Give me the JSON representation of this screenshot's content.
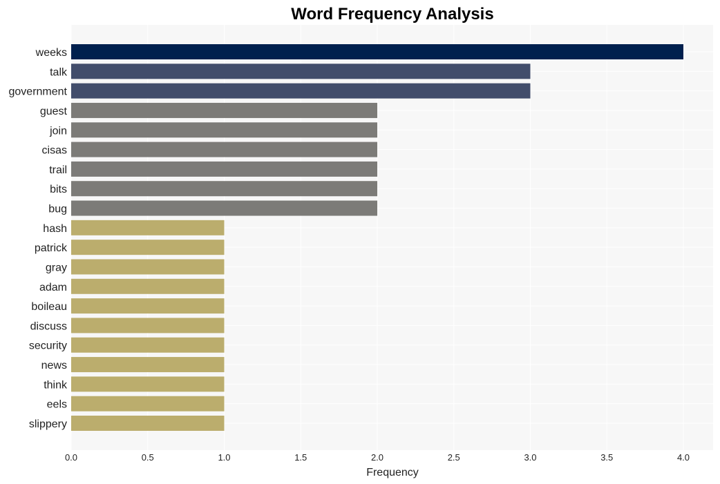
{
  "chart_data": {
    "type": "bar",
    "orientation": "horizontal",
    "title": "Word Frequency Analysis",
    "xlabel": "Frequency",
    "ylabel": "",
    "xlim": [
      0,
      4.2
    ],
    "xticks": [
      "0.0",
      "0.5",
      "1.0",
      "1.5",
      "2.0",
      "2.5",
      "3.0",
      "3.5",
      "4.0"
    ],
    "grid": true,
    "categories": [
      "weeks",
      "talk",
      "government",
      "guest",
      "join",
      "cisas",
      "trail",
      "bits",
      "bug",
      "hash",
      "patrick",
      "gray",
      "adam",
      "boileau",
      "discuss",
      "security",
      "news",
      "think",
      "eels",
      "slippery"
    ],
    "values": [
      4,
      3,
      3,
      2,
      2,
      2,
      2,
      2,
      2,
      1,
      1,
      1,
      1,
      1,
      1,
      1,
      1,
      1,
      1,
      1
    ],
    "colors": {
      "4": "#00204e",
      "3": "#424d6b",
      "2": "#7c7b78",
      "1": "#bbad6d"
    },
    "background": "#f7f7f7"
  }
}
